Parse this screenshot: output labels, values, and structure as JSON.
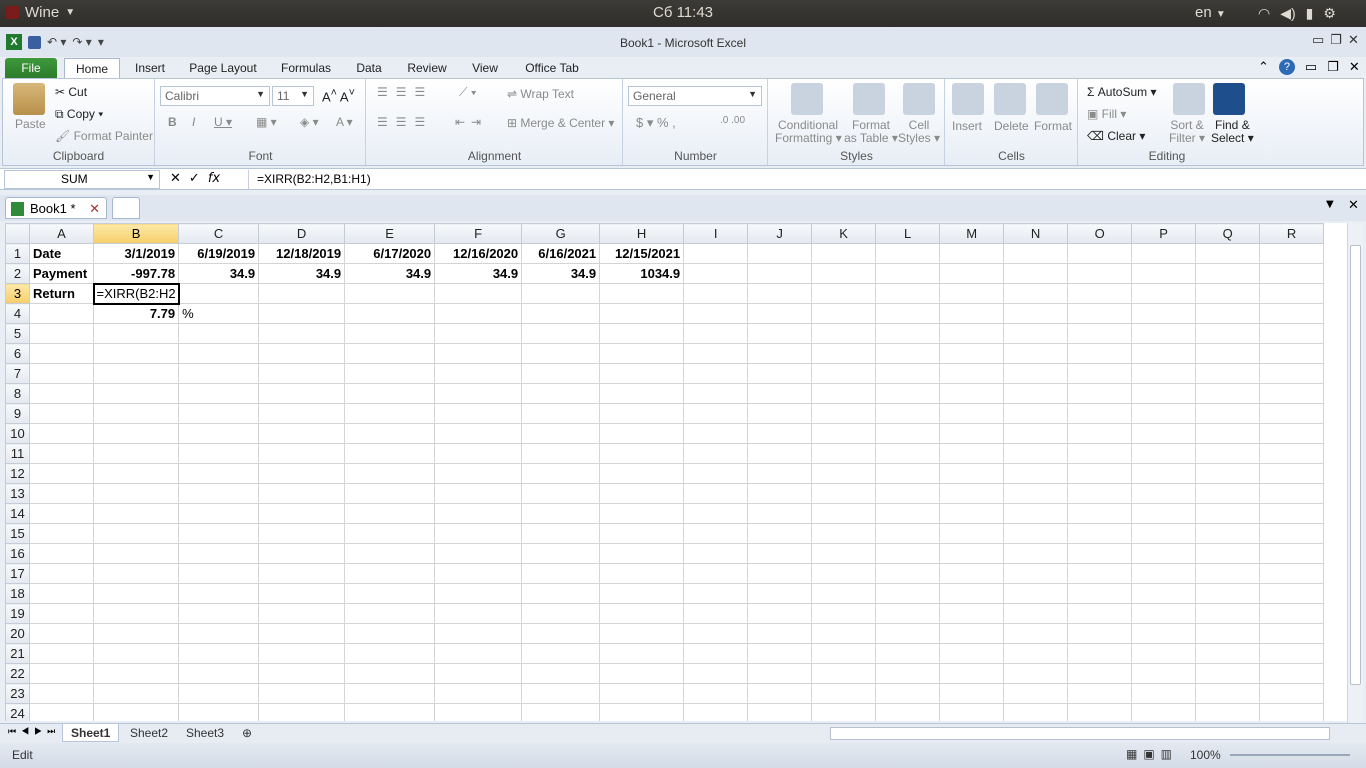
{
  "system": {
    "app": "Wine",
    "clock": "Сб 11:43",
    "lang": "en"
  },
  "window": {
    "title": "Book1 - Microsoft Excel"
  },
  "ribbon_tabs": [
    "File",
    "Home",
    "Insert",
    "Page Layout",
    "Formulas",
    "Data",
    "Review",
    "View",
    "Office Tab"
  ],
  "clipboard": {
    "paste": "Paste",
    "cut": "Cut",
    "copy": "Copy",
    "format_painter": "Format Painter",
    "label": "Clipboard"
  },
  "font": {
    "name": "Calibri",
    "size": "11",
    "label": "Font"
  },
  "alignment": {
    "wrap": "Wrap Text",
    "merge": "Merge & Center",
    "label": "Alignment"
  },
  "number": {
    "format": "General",
    "label": "Number"
  },
  "styles": {
    "conditional": "Conditional",
    "conditional2": "Formatting",
    "format_table": "Format",
    "format_table2": "as Table",
    "cell_styles": "Cell",
    "cell_styles2": "Styles",
    "label": "Styles"
  },
  "cells": {
    "insert": "Insert",
    "delete": "Delete",
    "format": "Format",
    "label": "Cells"
  },
  "editing": {
    "autosum": "AutoSum",
    "fill": "Fill",
    "clear": "Clear",
    "sort": "Sort &",
    "sort2": "Filter",
    "find": "Find &",
    "find2": "Select",
    "label": "Editing"
  },
  "formula_bar": {
    "name_box": "SUM",
    "formula": "=XIRR(B2:H2,B1:H1)"
  },
  "workbook_tab": "Book1 *",
  "columns": [
    "A",
    "B",
    "C",
    "D",
    "E",
    "F",
    "G",
    "H",
    "I",
    "J",
    "K",
    "L",
    "M",
    "N",
    "O",
    "P",
    "Q",
    "R"
  ],
  "rows": {
    "r1": [
      "Date",
      "3/1/2019",
      "6/19/2019",
      "12/18/2019",
      "6/17/2020",
      "12/16/2020",
      "6/16/2021",
      "12/15/2021"
    ],
    "r2": [
      "Payment",
      "-997.78",
      "34.9",
      "34.9",
      "34.9",
      "34.9",
      "34.9",
      "1034.9"
    ],
    "r3": [
      "Return",
      "=XIRR(B2:H2"
    ],
    "r4": [
      "",
      "7.79",
      "%"
    ]
  },
  "sheets": [
    "Sheet1",
    "Sheet2",
    "Sheet3"
  ],
  "status": {
    "mode": "Edit",
    "zoom": "100%"
  }
}
